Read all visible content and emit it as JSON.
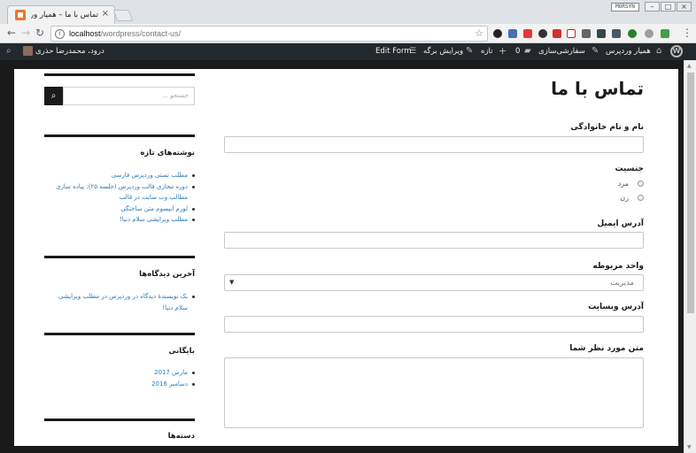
{
  "browser": {
    "tab_title": "تماس با ما – همیار وردپرس",
    "tab_close": "×",
    "badge": "MORSYN",
    "url_host": "localhost",
    "url_path": "/wordpress/contact-us/",
    "icons": [
      "back-arrow-icon",
      "forward-arrow-icon",
      "reload-icon",
      "info-icon",
      "star-icon",
      "menu-dots-icon"
    ]
  },
  "adminbar": {
    "site_name": "همیار وردپرس",
    "customize": "سفارشی‌سازی",
    "comments_count": "0",
    "new_label": "تازه",
    "edit_page": "ویرایش برگه",
    "edit_form": "Edit Form",
    "greeting": "درود، محمدرضا حذری"
  },
  "form": {
    "title": "تماس با ما",
    "name_label": "نام و نام خانوادگی",
    "gender_label": "جنسیت",
    "gender_options": [
      "مرد",
      "زن"
    ],
    "email_label": "آدرس ایمیل",
    "unit_label": "واحد مربوطه",
    "unit_value": "مدیریت",
    "website_label": "آدرس وبسایت",
    "message_label": "متن مورد نظر شما"
  },
  "sidebar": {
    "search_placeholder": "جستجو …",
    "recent_posts_title": "نوشته‌های تازه",
    "recent_posts": [
      "مطلب تستی وردپرس فارسی",
      "دوره مجازی قالب وردپرس (جلسه ۲۵): پیاده سازی مطالب وب سایت در قالب",
      "لورم ایپسوم متن ساختگی",
      "مطلب ویرایشی سلام دنیا!"
    ],
    "recent_comments_title": "آخرین دیدگاه‌ها",
    "recent_comments": [
      "یک نویسندهٔ دیدگاه در وردپرس در مطلب ویرایشی سلام دنیا!"
    ],
    "archives_title": "بایگانی",
    "archives": [
      "مارس 2017",
      "دسامبر 2016"
    ],
    "categories_title": "دسته‌ها"
  },
  "colors": {
    "link": "#2b7bb9",
    "admin_bar": "#23282d",
    "page_bg": "#1a1a1a"
  }
}
